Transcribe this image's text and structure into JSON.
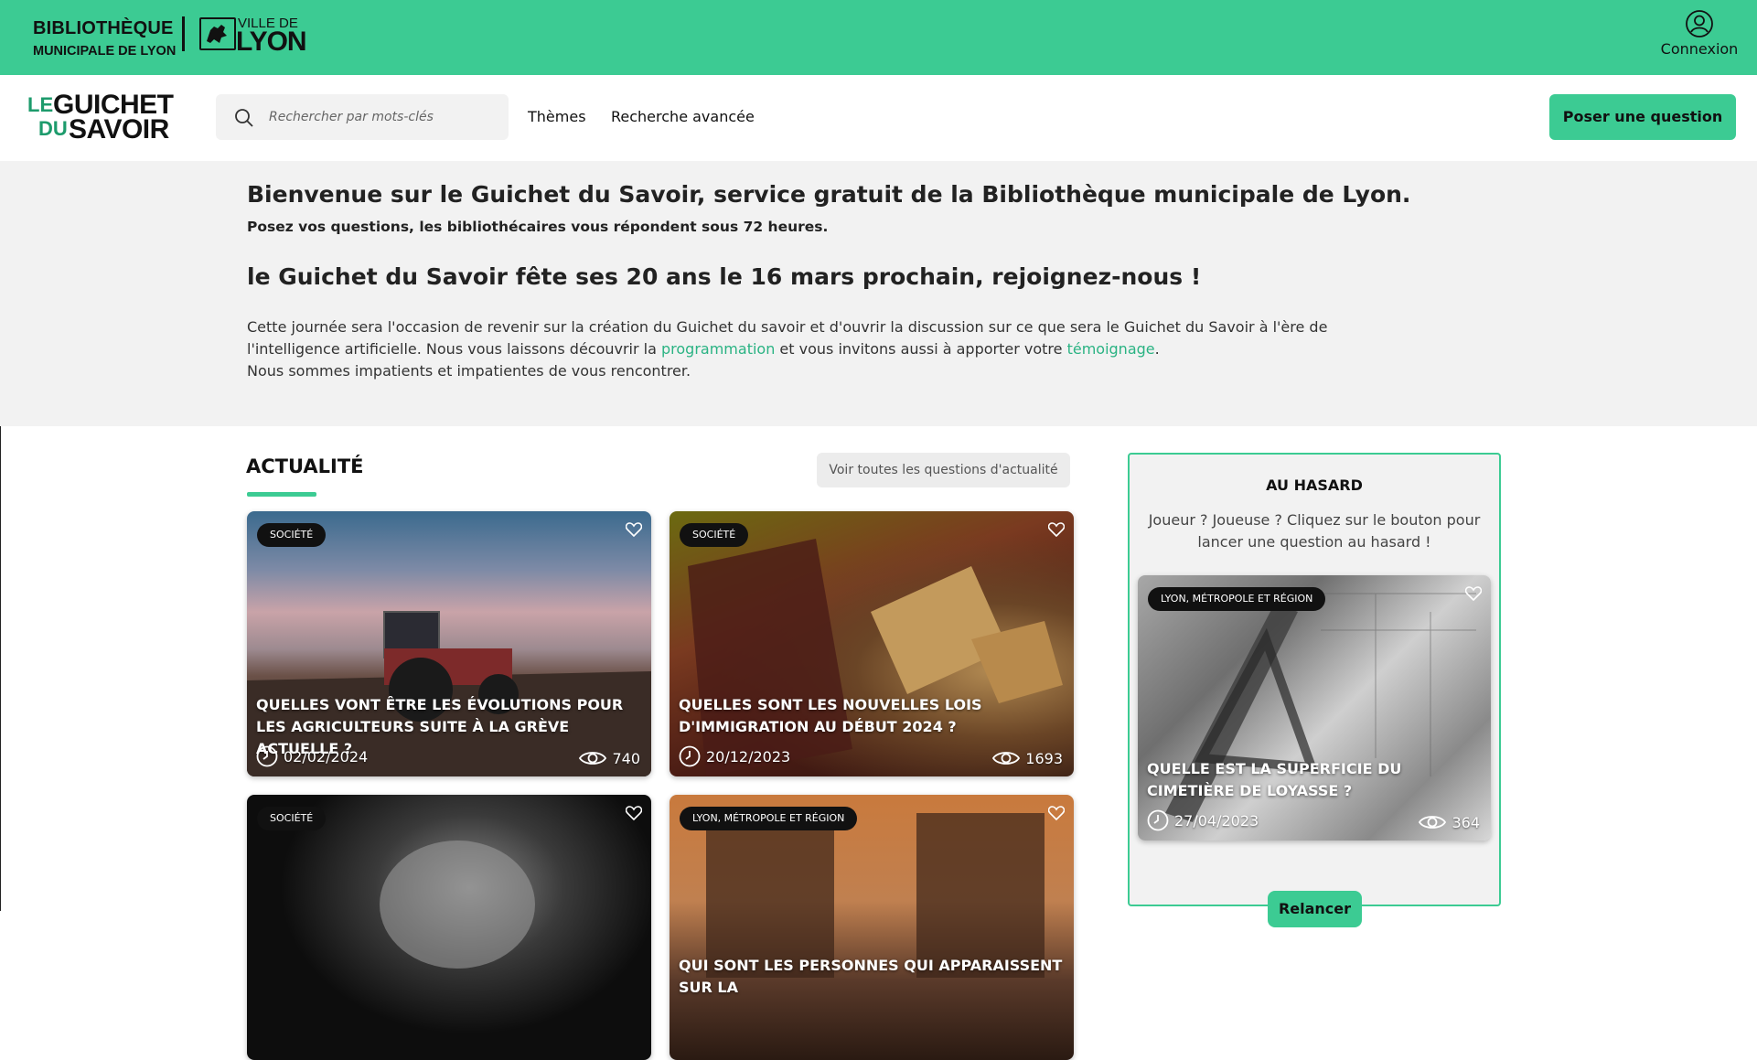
{
  "header": {
    "library_line1": "BIBLIOTHÈQUE",
    "library_line2": "MUNICIPALE DE LYON",
    "city_line1": "VILLE DE",
    "city_line2": "LYON",
    "login_label": "Connexion"
  },
  "nav": {
    "logo_le": "LE",
    "logo_guichet": "GUICHET",
    "logo_du": "DU",
    "logo_savoir": "SAVOIR",
    "search_placeholder": "Rechercher par mots-clés",
    "themes_label": "Thèmes",
    "advanced_search_label": "Recherche avancée",
    "ask_button_label": "Poser une question"
  },
  "welcome": {
    "title": "Bienvenue sur le Guichet du Savoir, service gratuit de la Bibliothèque municipale de Lyon.",
    "subtitle": "Posez vos questions, les bibliothécaires vous répondent sous 72 heures.",
    "event_title": "le Guichet du Savoir fête ses 20 ans le 16 mars prochain, rejoignez-nous !",
    "para_part1": "Cette journée sera l'occasion de revenir sur la création du Guichet du savoir et d'ouvrir la discussion sur ce que sera le Guichet du Savoir à l'ère de l'intelligence artificielle. Nous vous laissons découvrir la ",
    "link_programmation": "programmation",
    "para_part2": " et vous invitons aussi à apporter votre ",
    "link_temoignage": "témoignage",
    "para_part3": ".",
    "para_line3": "Nous sommes impatients et impatientes de vous rencontrer."
  },
  "news": {
    "title": "ACTUALITÉ",
    "see_all_label": "Voir toutes les questions d'actualité",
    "cards": [
      {
        "tag": "SOCIÉTÉ",
        "title": "QUELLES VONT ÊTRE LES ÉVOLUTIONS POUR LES AGRICULTEURS SUITE À LA GRÈVE ACTUELLE ?",
        "date": "02/02/2024",
        "views": "740"
      },
      {
        "tag": "SOCIÉTÉ",
        "title": "QUELLES SONT LES NOUVELLES LOIS D'IMMIGRATION AU DÉBUT 2024 ?",
        "date": "20/12/2023",
        "views": "1693"
      },
      {
        "tag": "SOCIÉTÉ"
      },
      {
        "tag": "LYON, MÉTROPOLE ET RÉGION",
        "title": "QUI SONT LES PERSONNES QUI APPARAISSENT SUR LA"
      }
    ]
  },
  "random": {
    "title": "AU HASARD",
    "description": "Joueur ? Joueuse ? Cliquez sur le bouton pour lancer une question au hasard !",
    "card": {
      "tag": "LYON, MÉTROPOLE ET RÉGION",
      "title": "QUELLE EST LA SUPERFICIE DU CIMETIÈRE DE LOYASSE ?",
      "date": "27/04/2023",
      "views": "364"
    },
    "reload_label": "Relancer"
  },
  "colors": {
    "brand_green": "#3ccb93",
    "link_green": "#2ab383",
    "welcome_bg": "#f2f2f2"
  }
}
